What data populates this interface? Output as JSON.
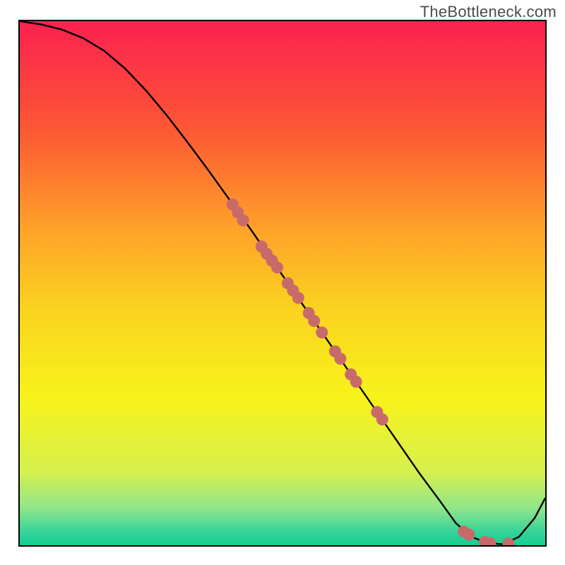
{
  "watermark": "TheBottleneck.com",
  "colors": {
    "curve": "#000000",
    "marker_fill": "#c96a6a",
    "marker_stroke": "#9e4a4a",
    "gradient_stops": [
      {
        "offset": 0.0,
        "color": "#fb2150"
      },
      {
        "offset": 0.2,
        "color": "#fd5535"
      },
      {
        "offset": 0.4,
        "color": "#fea329"
      },
      {
        "offset": 0.55,
        "color": "#fad31f"
      },
      {
        "offset": 0.72,
        "color": "#f7f31a"
      },
      {
        "offset": 0.86,
        "color": "#d6f04e"
      },
      {
        "offset": 0.93,
        "color": "#8fe58a"
      },
      {
        "offset": 0.975,
        "color": "#34d39a"
      },
      {
        "offset": 1.0,
        "color": "#16cf8f"
      }
    ]
  },
  "chart_data": {
    "type": "line",
    "title": "",
    "xlabel": "",
    "ylabel": "",
    "xlim": [
      0,
      100
    ],
    "ylim": [
      0,
      100
    ],
    "series": [
      {
        "name": "bottleneck-curve",
        "x": [
          0,
          4,
          8,
          12,
          16,
          20,
          24,
          28,
          32,
          36,
          40,
          44,
          48,
          52,
          56,
          60,
          64,
          68,
          72,
          76,
          80,
          83,
          86,
          89,
          92,
          95,
          98,
          100
        ],
        "y": [
          100,
          99.4,
          98.4,
          96.8,
          94.4,
          91.0,
          86.8,
          82.0,
          76.8,
          71.4,
          65.8,
          60.2,
          54.4,
          48.6,
          42.8,
          37.0,
          31.2,
          25.4,
          19.6,
          13.8,
          8.4,
          4.2,
          1.6,
          0.4,
          0.2,
          1.6,
          5.2,
          9.0
        ]
      }
    ],
    "markers": {
      "name": "sample-points",
      "points": [
        {
          "x": 40.5,
          "y": 65.0
        },
        {
          "x": 41.5,
          "y": 63.5
        },
        {
          "x": 42.5,
          "y": 62.0
        },
        {
          "x": 46.0,
          "y": 57.0
        },
        {
          "x": 47.0,
          "y": 55.6
        },
        {
          "x": 48.0,
          "y": 54.3
        },
        {
          "x": 49.0,
          "y": 53.0
        },
        {
          "x": 51.0,
          "y": 50.0
        },
        {
          "x": 52.0,
          "y": 48.6
        },
        {
          "x": 53.0,
          "y": 47.2
        },
        {
          "x": 55.0,
          "y": 44.3
        },
        {
          "x": 56.0,
          "y": 42.8
        },
        {
          "x": 57.5,
          "y": 40.6
        },
        {
          "x": 60.0,
          "y": 37.0
        },
        {
          "x": 61.0,
          "y": 35.6
        },
        {
          "x": 63.0,
          "y": 32.6
        },
        {
          "x": 64.0,
          "y": 31.2
        },
        {
          "x": 68.0,
          "y": 25.4
        },
        {
          "x": 69.0,
          "y": 24.0
        },
        {
          "x": 84.5,
          "y": 2.6
        },
        {
          "x": 85.5,
          "y": 2.0
        },
        {
          "x": 88.5,
          "y": 0.6
        },
        {
          "x": 89.5,
          "y": 0.4
        },
        {
          "x": 93.0,
          "y": 0.3
        }
      ]
    }
  }
}
